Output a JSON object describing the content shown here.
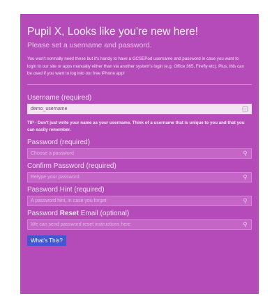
{
  "header": {
    "title": "Pupil X, Looks like you're new here!",
    "subtitle": "Please set a username and password."
  },
  "intro": "You won't normally need these but it's handy to have a GCSEPod username and password in case you want to login to our site or apps manually either than via another system's login (e.g. Office 365, Firefly etc). Plus, this can be used if you want to log into our free iPhone app!",
  "tip": "TIP - Don't just write your name as your username. Think of a username that is unique to you and that you can easily remember.",
  "fields": [
    {
      "label": "Username (required)",
      "value": "demo_username",
      "placeholder": "",
      "icon": "key-icon"
    },
    {
      "label": "Password (required)",
      "value": "",
      "placeholder": "Choose a password",
      "icon": "key-icon"
    },
    {
      "label": "Confirm Password (required)",
      "value": "",
      "placeholder": "Retype your password",
      "icon": "key-icon"
    },
    {
      "label": "Password Hint (required)",
      "value": "",
      "placeholder": "A password hint, in case you forget",
      "icon": "key-icon"
    },
    {
      "label_pre": "Password ",
      "label_bold": "Reset",
      "label_post": " Email (optional)",
      "value": "",
      "placeholder": "We can send password reset instructions here",
      "icon": "key-icon"
    }
  ],
  "button": {
    "label": "What's This?"
  },
  "colors": {
    "panel": "#b44bb8",
    "input": "#c565c8",
    "input_filled": "#f3e4f4",
    "button": "#4257d6"
  }
}
